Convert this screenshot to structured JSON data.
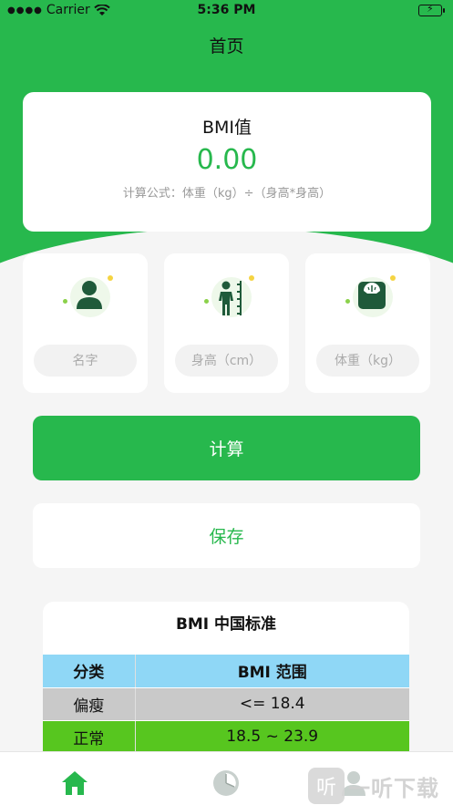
{
  "status_bar": {
    "carrier": "Carrier",
    "time": "5:36 PM"
  },
  "nav": {
    "title": "首页"
  },
  "bmi_card": {
    "label": "BMI值",
    "value": "0.00",
    "formula": "计算公式：体重（kg）÷（身高*身高）"
  },
  "inputs": {
    "name": {
      "placeholder": "名字",
      "icon": "person-icon"
    },
    "height": {
      "placeholder": "身高（cm）",
      "icon": "height-measure-icon"
    },
    "weight": {
      "placeholder": "体重（kg）",
      "icon": "scale-icon"
    }
  },
  "buttons": {
    "calculate": "计算",
    "save": "保存"
  },
  "standard": {
    "title": "BMI 中国标准",
    "header": {
      "category": "分类",
      "range": "BMI 范围"
    },
    "rows": [
      {
        "category": "偏瘦",
        "range": "<= 18.4"
      },
      {
        "category": "正常",
        "range": "18.5 ~ 23.9"
      }
    ]
  },
  "tabs": [
    {
      "icon": "home-icon",
      "active": true
    },
    {
      "icon": "pie-chart-icon",
      "active": false
    },
    {
      "icon": "profile-icon",
      "active": false
    }
  ],
  "watermark": {
    "logo": "听",
    "text": "一听下载"
  },
  "colors": {
    "primary": "#27b84d",
    "thin_row": "#c9c9c9",
    "normal_row": "#57c61f",
    "header_row": "#8fd7f6"
  }
}
